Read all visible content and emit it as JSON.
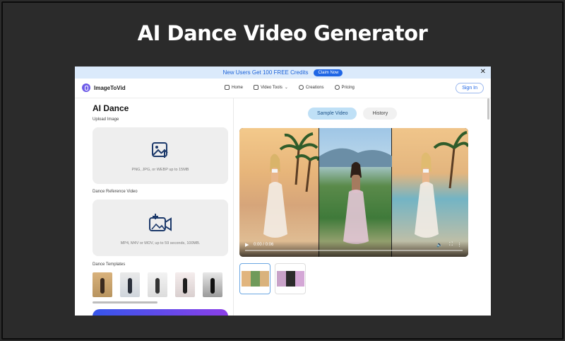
{
  "page": {
    "heading": "AI Dance Video Generator"
  },
  "promo": {
    "text": "New Users Get 100 FREE Credits",
    "button": "Claim Now",
    "close": "✕"
  },
  "nav": {
    "brand": "ImageToVid",
    "items": [
      {
        "label": "Home",
        "icon": "home-icon"
      },
      {
        "label": "Video Tools",
        "icon": "video-tools-icon",
        "caret": "⌄"
      },
      {
        "label": "Creations",
        "icon": "creations-icon"
      },
      {
        "label": "Pricing",
        "icon": "pricing-icon"
      }
    ],
    "signin": "Sign In"
  },
  "left": {
    "title": "AI Dance",
    "upload_label": "Upload Image",
    "upload_hint": "PNG, JPG, or WEBP up to 15MB",
    "dance_label": "Dance Reference Video",
    "dance_hint": "MP4, M4V or MOV, up to 59 seconds, 100MB.",
    "templates_label": "Dance Templates"
  },
  "right": {
    "tabs": [
      "Sample Video",
      "History"
    ],
    "video_time": "0:00 / 0:06"
  },
  "colors": {
    "accent": "#1f66e5",
    "promo_bg": "#dbeafb",
    "brand_mark": "#6d5be8",
    "tab_active": "#bfe0f6"
  }
}
